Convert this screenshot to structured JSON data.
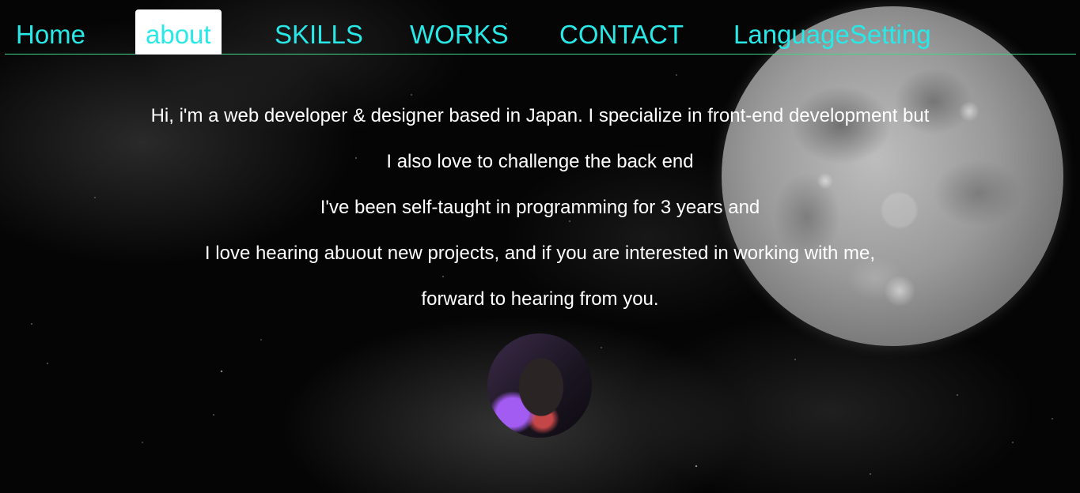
{
  "nav": {
    "items": [
      {
        "label": "Home"
      },
      {
        "label": "about"
      },
      {
        "label": "SKILLS"
      },
      {
        "label": "WORKS"
      },
      {
        "label": "CONTACT"
      },
      {
        "label": "LanguageSetting"
      }
    ],
    "active": "about",
    "accent_color": "#29e8e8",
    "underline_color": "#3dd68c"
  },
  "about": {
    "lines": [
      "Hi, i'm a web developer & designer based in Japan. I specialize in front-end development but",
      "I also love to challenge the back end",
      "I've been self-taught in programming for 3 years and",
      "I love hearing abuout new projects, and if you are interested in working with me,",
      "forward to hearing from you."
    ]
  },
  "profile": {
    "avatar_icon": "profile-photo"
  },
  "background": {
    "moon_icon": "moon-image",
    "stars_icon": "starfield"
  }
}
